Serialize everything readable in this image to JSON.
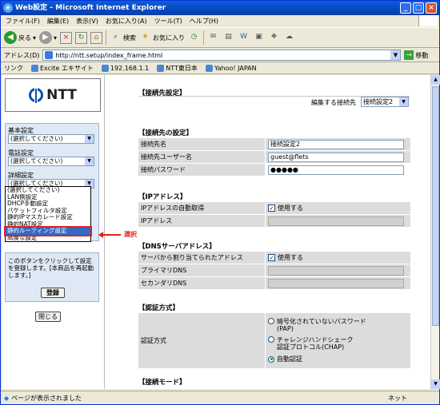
{
  "window": {
    "title": "Web設定 - Microsoft Internet Explorer",
    "min": "_",
    "max": "□",
    "close": "×"
  },
  "menu": [
    "ファイル(F)",
    "編集(E)",
    "表示(V)",
    "お気に入り(A)",
    "ツール(T)",
    "ヘルプ(H)"
  ],
  "toolbar": {
    "back": "戻る",
    "search": "検索",
    "favorites": "お気に入り",
    "back_glyph": "◀",
    "fwd_glyph": "▶",
    "stop_glyph": "×",
    "refresh_glyph": "↻",
    "home_glyph": "⌂"
  },
  "address": {
    "label": "アドレス(D)",
    "url": "http://ntt.setup/index_frame.html",
    "go": "移動"
  },
  "links": {
    "label": "リンク",
    "items": [
      "Excite エキサイト",
      "192.168.1.1",
      "NTT東日本",
      "Yahoo! JAPAN"
    ]
  },
  "status": {
    "text": "ページが表示されました",
    "zone": "ネット"
  },
  "left": {
    "logo": "NTT",
    "basic_label": "基本設定",
    "phone_label": "電話設定",
    "detail_label": "詳細設定",
    "select_placeholder": "(選択してください)",
    "dropdown_items": [
      "(選択してください)",
      "LAN側設定",
      "DHCP手動設定",
      "パケットフィルタ設定",
      "静的IPマスカレード設定",
      "静的NAT設定",
      "静的ルーティング設定",
      "高度な設定"
    ],
    "annotation": "選択",
    "message": "このボタンをクリックして設定を登録します。[本商品を再起動します。]",
    "register": "登録",
    "close": "閉じる"
  },
  "right": {
    "title": "【接続先設定】",
    "edit_label": "編集する接続先",
    "edit_value": "接続設定2",
    "conn_head": "【接続先の設定】",
    "conn_name_label": "接続先名",
    "conn_name_value": "接続設定2",
    "user_label": "接続先ユーザー名",
    "user_value": "guest@flets",
    "pass_label": "接続パスワード",
    "pass_value": "●●●●●",
    "ip_head": "【IPアドレス】",
    "ip_auto_label": "IPアドレスの自動取得",
    "use": "使用する",
    "ip_label": "IPアドレス",
    "dns_head": "【DNSサーバアドレス】",
    "dns_auto_label": "サーバから割り当てられたアドレス",
    "dns1_label": "プライマリDNS",
    "dns2_label": "セカンダリDNS",
    "auth_head": "【認証方式】",
    "auth_label": "認証方式",
    "auth_pap_1": "暗号化されていないパスワード",
    "auth_pap_2": "(PAP)",
    "auth_chap_1": "チャレンジハンドシェーク",
    "auth_chap_2": "認証プロトコル(CHAP)",
    "auth_auto": "自動認証",
    "mode_head": "【接続モード】"
  }
}
